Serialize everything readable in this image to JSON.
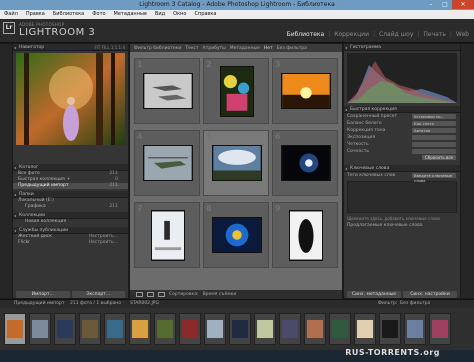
{
  "window": {
    "title": "Lightroom 3 Catalog - Adobe Photoshop Lightroom - Библиотека",
    "controls": [
      "–",
      "□",
      "✕"
    ]
  },
  "menu": [
    "Файл",
    "Правка",
    "Библиотека",
    "Фото",
    "Метаданные",
    "Вид",
    "Окно",
    "Справка"
  ],
  "identity": {
    "logo": "Lr",
    "line1": "ADOBE PHOTOSHOP",
    "line2": "LIGHTROOM 3"
  },
  "modules": [
    "Библиотека",
    "Коррекции",
    "Слайд шоу",
    "Печать",
    "Web"
  ],
  "left_panel": {
    "navigator": {
      "title": "Навигатор",
      "zoom": "FIT  FILL  1:1  1:4"
    },
    "catalog": {
      "title": "Каталог",
      "items": [
        {
          "label": "Все фото",
          "count": "211"
        },
        {
          "label": "Быстрая коллекция +",
          "count": "0"
        },
        {
          "label": "Предыдущий импорт",
          "count": "211"
        }
      ]
    },
    "folders": {
      "title": "Папки",
      "items": [
        {
          "label": "Локальный (E:)",
          "count": ""
        },
        {
          "label": "Графика",
          "count": "211"
        }
      ]
    },
    "collections": {
      "title": "Коллекции",
      "items": [
        {
          "label": "Новая коллекция",
          "count": ""
        }
      ]
    },
    "publish": {
      "title": "Службы публикации",
      "items": [
        {
          "label": "Жесткий диск",
          "action": "Настроить..."
        },
        {
          "label": "Flickr",
          "action": "Настроить..."
        }
      ]
    },
    "import_button": "Импорт...",
    "export_button": "Экспорт..."
  },
  "filter_bar": {
    "label": "Фильтр библиотеки",
    "items": [
      "Текст",
      "Атрибуты",
      "Метаданные",
      "Нет"
    ],
    "right": "Без фильтра"
  },
  "toolbar": {
    "sort_label": "Сортировка:",
    "sort_value": "Время съёмки"
  },
  "right_panel": {
    "histogram": {
      "title": "Гистограмма"
    },
    "quick_develop": {
      "title": "Быстрая коррекция",
      "rows": [
        {
          "label": "Сохраненный пресет",
          "value": "Установки по..."
        },
        {
          "label": "Баланс белого",
          "value": "Как снято"
        },
        {
          "label": "Коррекция тона",
          "value": "Автотон"
        },
        {
          "label": "Экспозиция",
          "value": ""
        },
        {
          "label": "Четкость",
          "value": ""
        },
        {
          "label": "Сочность",
          "value": ""
        }
      ],
      "reset_button": "Сбросить все"
    },
    "keywords": {
      "title": "Ключевые слова",
      "tags_label": "Теги ключевых слов",
      "tags_value": "Введите ключевые слова",
      "hint": "Щелкните здесь, добавить ключевые слова",
      "suggestions": "Предлагаемые ключевые слова"
    },
    "sync_button": "Синх. метаданные",
    "sync_settings_button": "Синх. настройки"
  },
  "filmstrip_bar": {
    "source": "Предыдущий импорт",
    "info": "211 фото / 1 выбрано",
    "filename": "STAR002.JPG",
    "filter_label": "Фильтр:",
    "filter_value": "Без фильтра"
  },
  "watermark": "RUS-TORRENTS.org"
}
